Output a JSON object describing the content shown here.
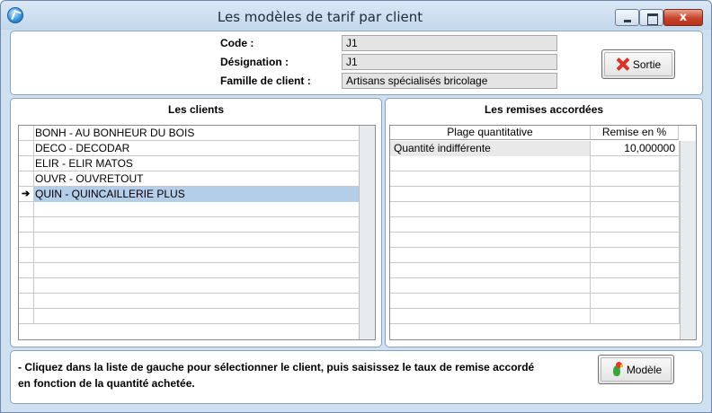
{
  "window": {
    "title": "Les modèles de tarif par client",
    "close_glyph": "x"
  },
  "header": {
    "code_label": "Code :",
    "code_value": "J1",
    "designation_label": "Désignation :",
    "designation_value": "J1",
    "famille_label": "Famille de client :",
    "famille_value": "Artisans spécialisés bricolage",
    "sortie_label": "Sortie"
  },
  "clients": {
    "title": "Les clients",
    "current_marker": "➔",
    "rows": [
      "BONH - AU BONHEUR DU BOIS",
      "DECO - DECODAR",
      "ELIR - ELIR MATOS",
      "OUVR - OUVRETOUT",
      "QUIN - QUINCAILLERIE PLUS",
      "",
      "",
      "",
      "",
      "",
      "",
      "",
      ""
    ],
    "selected_index": 4
  },
  "remises": {
    "title": "Les remises accordées",
    "columns": [
      "Plage quantitative",
      "Remise en %"
    ],
    "rows": [
      [
        "Quantité indifférente",
        "10,000000"
      ],
      [
        "",
        ""
      ],
      [
        "",
        ""
      ],
      [
        "",
        ""
      ],
      [
        "",
        ""
      ],
      [
        "",
        ""
      ],
      [
        "",
        ""
      ],
      [
        "",
        ""
      ],
      [
        "",
        ""
      ],
      [
        "",
        ""
      ],
      [
        "",
        ""
      ],
      [
        "",
        ""
      ]
    ]
  },
  "footer": {
    "instruction_line1": "- Cliquez dans la liste de gauche pour sélectionner le client, puis saisissez le taux de remise accordé",
    "instruction_line2": "en fonction de la quantité achetée.",
    "modele_label": "Modèle"
  },
  "colors": {
    "window_bg": "#cfe0f0",
    "selection": "#b4cde8",
    "field_bg": "#e4e4e4",
    "close_red": "#c7432a"
  },
  "icons": {
    "app": "app-logo-icon",
    "sortie": "red-x-icon",
    "modele": "parrot-icon"
  }
}
